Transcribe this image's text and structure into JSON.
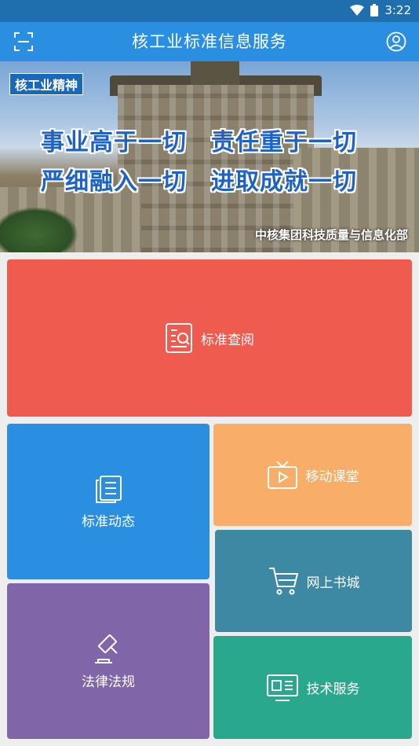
{
  "status_bar": {
    "time": "3:22",
    "wifi_icon": "wifi-icon",
    "battery_icon": "battery-icon"
  },
  "app_bar": {
    "title": "核工业标准信息服务",
    "left_icon": "scan-icon",
    "right_icon": "user-icon"
  },
  "banner": {
    "tag": "核工业精神",
    "slogan_line1": "事业高于一切　责任重于一切",
    "slogan_line2": "严细融入一切　进取成就一切",
    "caption": "中核集团科技质量与信息化部"
  },
  "tiles": {
    "standard_lookup": {
      "label": "标准查阅",
      "icon": "document-search-icon",
      "color": "#ef5b4f"
    },
    "standard_news": {
      "label": "标准动态",
      "icon": "documents-icon",
      "color": "#2b8fe1"
    },
    "mobile_course": {
      "label": "移动课堂",
      "icon": "tv-play-icon",
      "color": "#f8ae68"
    },
    "online_bookstore": {
      "label": "网上书城",
      "icon": "cart-icon",
      "color": "#3d88a3"
    },
    "laws_regulations": {
      "label": "法律法规",
      "icon": "gavel-icon",
      "color": "#8065a8"
    },
    "technical_service": {
      "label": "技术服务",
      "icon": "monitor-icon",
      "color": "#2aa88d"
    }
  }
}
